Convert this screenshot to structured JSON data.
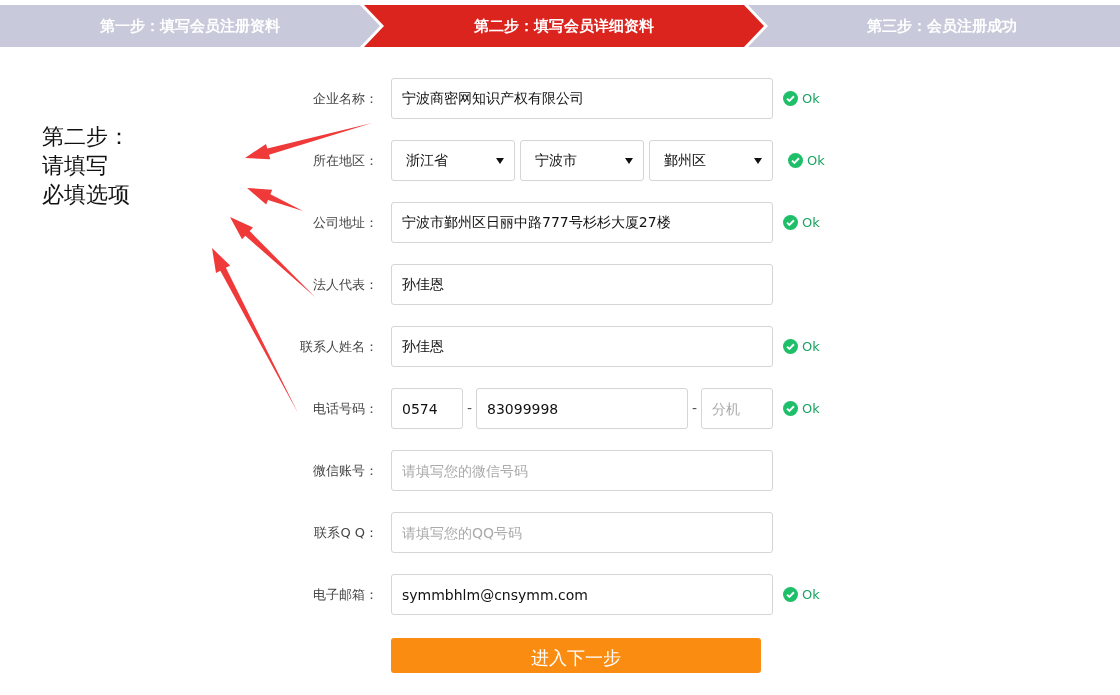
{
  "steps": [
    {
      "label": "第一步：填写会员注册资料",
      "selected": false
    },
    {
      "label": "第二步：填写会员详细资料",
      "selected": true
    },
    {
      "label": "第三步：会员注册成功",
      "selected": false
    }
  ],
  "annotation": {
    "lines": [
      "第二步：",
      "请填写",
      "必填选项"
    ]
  },
  "fields": [
    {
      "kind": "text",
      "label": "企业名称：",
      "value": "宁波商密网知识产权有限公司",
      "status": "Ok"
    },
    {
      "kind": "region",
      "label": "所在地区：",
      "options": [
        "浙江省",
        "宁波市",
        "鄞州区"
      ],
      "status": "Ok"
    },
    {
      "kind": "text",
      "label": "公司地址：",
      "value": "宁波市鄞州区日丽中路777号杉杉大厦27楼",
      "status": "Ok"
    },
    {
      "kind": "text",
      "label": "法人代表：",
      "value": "孙佳恩"
    },
    {
      "kind": "text",
      "label": "联系人姓名：",
      "value": "孙佳恩",
      "status": "Ok"
    },
    {
      "kind": "phone",
      "label": "电话号码：",
      "area": "0574",
      "number": "83099998",
      "separator": "-",
      "extension_placeholder": "分机",
      "status": "Ok"
    },
    {
      "kind": "text",
      "label": "微信账号：",
      "placeholder": "请填写您的微信号码"
    },
    {
      "kind": "text",
      "label": "联系Q Q：",
      "placeholder": "请填写您的QQ号码"
    },
    {
      "kind": "text",
      "label": "电子邮箱：",
      "value": "symmbhlm@cnsymm.com",
      "status": "Ok"
    }
  ],
  "submit": "进入下一步"
}
